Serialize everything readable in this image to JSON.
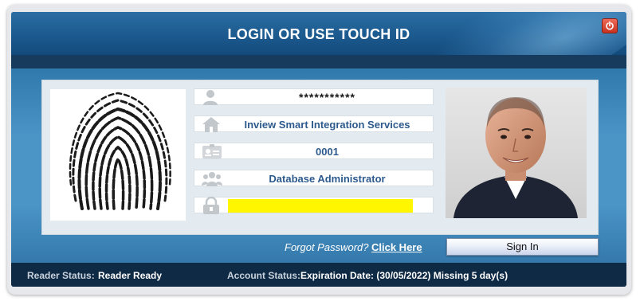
{
  "window": {
    "title": "LOGIN OR USE TOUCH ID",
    "close_icon": "power-icon",
    "close_color": "#d23a26"
  },
  "fields": {
    "username": {
      "icon": "user-icon",
      "value": "***********"
    },
    "company": {
      "icon": "home-icon",
      "value": "Inview Smart Integration Services"
    },
    "id_number": {
      "icon": "id-card-icon",
      "value": "0001"
    },
    "role": {
      "icon": "group-icon",
      "value": "Database Administrator"
    },
    "password": {
      "icon": "lock-icon",
      "value": "",
      "highlight_color": "#fff600"
    }
  },
  "images": {
    "fingerprint": "fingerprint-icon",
    "photo": "user-photo"
  },
  "actions": {
    "forgot_label": "Forgot Password?",
    "forgot_link": "Click Here",
    "sign_in": "Sign In"
  },
  "status": {
    "reader_label": "Reader Status:",
    "reader_value": "Reader Ready",
    "account_label": "Account Status:",
    "account_value": "Expiration Date: (30/05/2022) Missing 5  day(s)"
  }
}
